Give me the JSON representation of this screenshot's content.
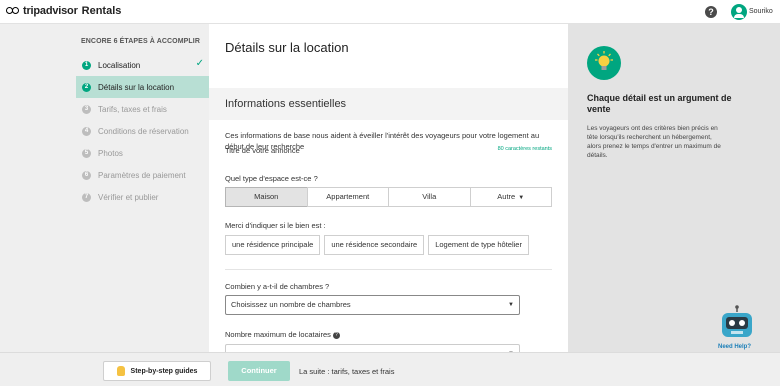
{
  "header": {
    "brand_name": "tripadvisor",
    "brand_product": "Rentals",
    "help_symbol": "?",
    "user_name": "Souriko"
  },
  "sidebar": {
    "title": "ENCORE 6 ÉTAPES À ACCOMPLIR",
    "steps": [
      {
        "num": "1",
        "label": "Localisation",
        "state": "done"
      },
      {
        "num": "2",
        "label": "Détails sur la location",
        "state": "active"
      },
      {
        "num": "3",
        "label": "Tarifs, taxes et frais",
        "state": "todo"
      },
      {
        "num": "4",
        "label": "Conditions de réservation",
        "state": "todo"
      },
      {
        "num": "5",
        "label": "Photos",
        "state": "todo"
      },
      {
        "num": "6",
        "label": "Paramètres de paiement",
        "state": "todo"
      },
      {
        "num": "7",
        "label": "Vérifier et publier",
        "state": "todo"
      }
    ],
    "check_symbol": "✓"
  },
  "main": {
    "title": "Détails sur la location",
    "section_title": "Informations essentielles",
    "intro": "Ces informations de base nous aident à éveiller l'intérêt des voyageurs pour votre logement au début de leur recherche",
    "listing_title_label": "Titre de votre annonce",
    "chars_left": "80 caractères restants",
    "space_type_label": "Quel type d'espace est-ce ?",
    "space_types": [
      "Maison",
      "Appartement",
      "Villa",
      "Autre"
    ],
    "space_type_selected": "Maison",
    "property_is_label": "Merci d'indiquer si le bien est :",
    "property_kinds": [
      "une résidence principale",
      "une résidence secondaire",
      "Logement de type hôtelier"
    ],
    "bedrooms_label": "Combien y a-t-il de chambres ?",
    "bedrooms_value": "Choisissez un nombre de chambres",
    "max_guests_label": "Nombre maximum de locataires"
  },
  "info_panel": {
    "icon": "lightbulb-icon",
    "title": "Chaque détail est un argument de vente",
    "text": "Les voyageurs ont des critères bien précis en tête lorsqu'ils recherchent un hébergement, alors prenez le temps d'entrer un maximum de détails."
  },
  "help_widget": {
    "label": "Need Help?"
  },
  "footer": {
    "guides_label": "Step-by-step guides",
    "continue_label": "Continuer",
    "next_label": "La suite : tarifs, taxes et frais"
  },
  "colors": {
    "accent": "#00a680",
    "active_step_bg": "#b8dfd4",
    "continue_disabled": "#9fd9c9",
    "help_link": "#1c7fb8"
  }
}
